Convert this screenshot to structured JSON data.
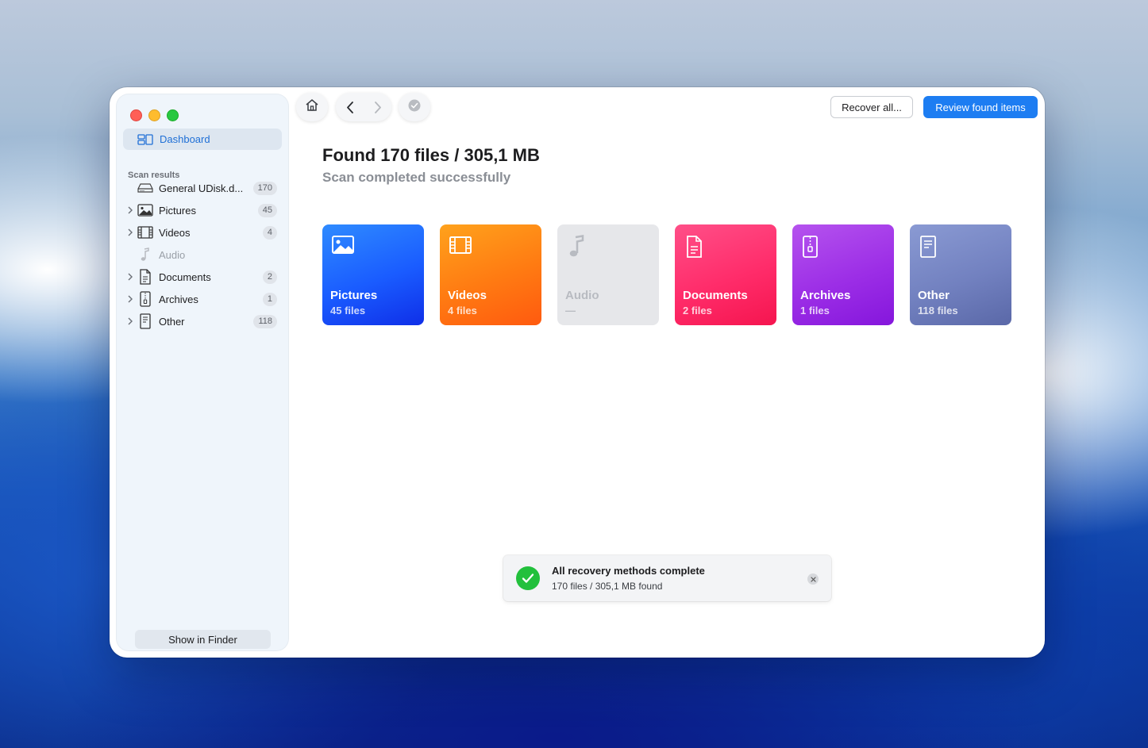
{
  "sidebar": {
    "dashboard_label": "Dashboard",
    "section_title": "Scan results",
    "items": [
      {
        "label": "General UDisk.d...",
        "count": "170",
        "icon": "drive-icon"
      },
      {
        "label": "Pictures",
        "count": "45",
        "icon": "picture-icon"
      },
      {
        "label": "Videos",
        "count": "4",
        "icon": "film-icon"
      },
      {
        "label": "Audio",
        "count": "",
        "icon": "music-note-icon"
      },
      {
        "label": "Documents",
        "count": "2",
        "icon": "document-icon"
      },
      {
        "label": "Archives",
        "count": "1",
        "icon": "archive-icon"
      },
      {
        "label": "Other",
        "count": "118",
        "icon": "other-file-icon"
      }
    ],
    "show_in_finder": "Show in Finder"
  },
  "toolbar": {
    "recover_all": "Recover all...",
    "review_found": "Review found items"
  },
  "main": {
    "headline": "Found 170 files / 305,1 MB",
    "subline": "Scan completed successfully",
    "tiles": [
      {
        "name": "Pictures",
        "count": "45 files"
      },
      {
        "name": "Videos",
        "count": "4 files"
      },
      {
        "name": "Audio",
        "count": "—"
      },
      {
        "name": "Documents",
        "count": "2 files"
      },
      {
        "name": "Archives",
        "count": "1 files"
      },
      {
        "name": "Other",
        "count": "118 files"
      }
    ]
  },
  "toast": {
    "title": "All recovery methods complete",
    "subtitle": "170 files / 305,1 MB found"
  },
  "colors": {
    "accent": "#1d7df2",
    "success": "#22c03c"
  }
}
